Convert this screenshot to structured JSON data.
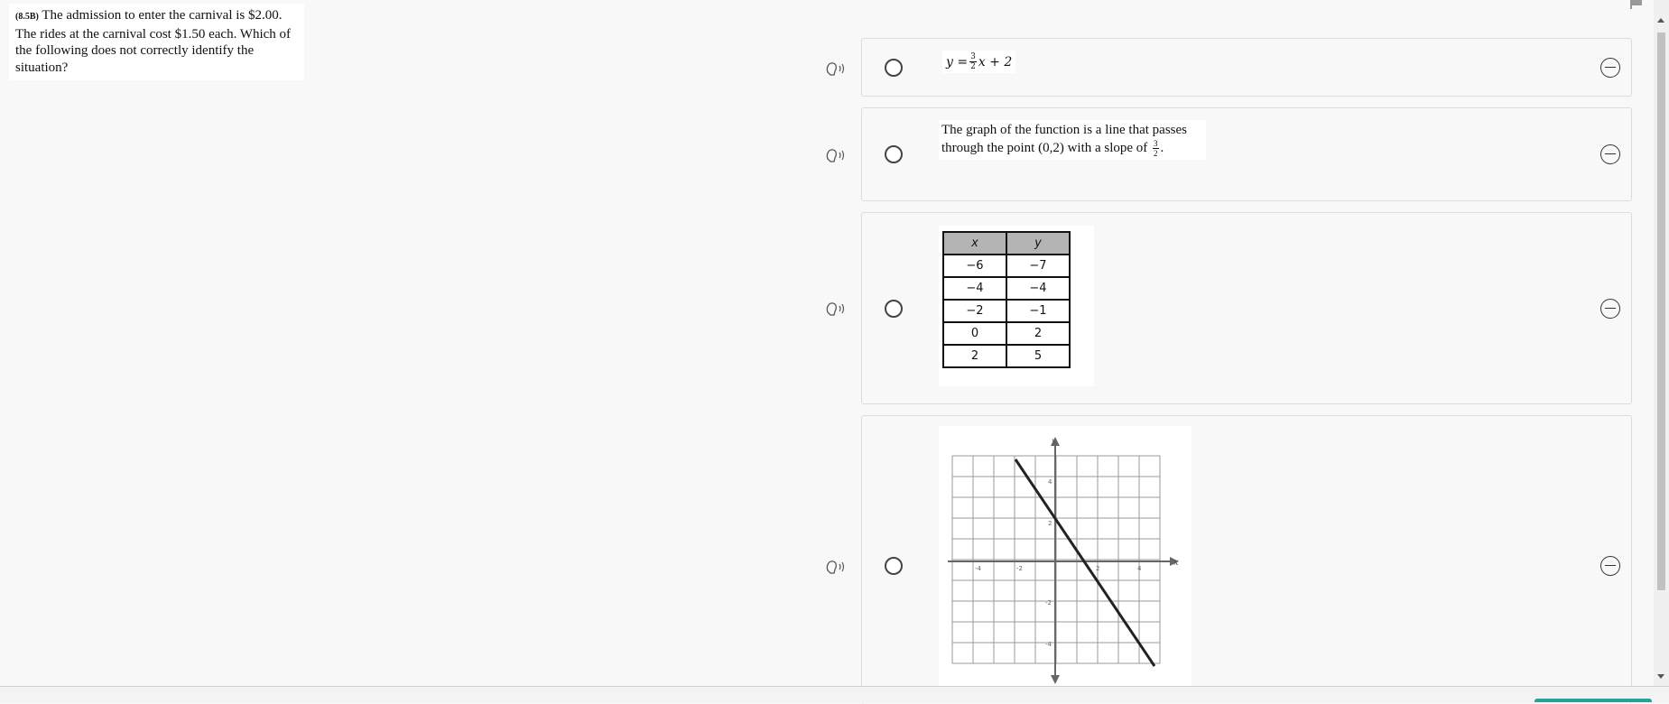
{
  "question": {
    "standard": "(8.5B)",
    "text": " The admission to enter the carnival is $2.00.  The rides at the carnival cost $1.50 each.  Which of the following does not correctly identify the situation?"
  },
  "options": {
    "a": {
      "equation_lhs": "y =",
      "frac_num": "3",
      "frac_den": "2",
      "equation_rhs": "x + 2"
    },
    "b": {
      "text": "The graph of the function is a line that passes through the point (0,2) with a slope of ",
      "frac_num": "3",
      "frac_den": "2",
      "end": "."
    },
    "c": {
      "headers": [
        "x",
        "y"
      ],
      "rows": [
        [
          "−6",
          "−7"
        ],
        [
          "−4",
          "−4"
        ],
        [
          "−2",
          "−1"
        ],
        [
          "0",
          "2"
        ],
        [
          "2",
          "5"
        ]
      ]
    },
    "d": {
      "graph_axis_x": "x",
      "graph_axis_y": "y",
      "tick_labels": [
        "-4",
        "-2",
        "2",
        "4",
        "4",
        "2",
        "-2",
        "-4"
      ]
    }
  },
  "icons": {
    "speak": "speaker-head-icon",
    "strike": "strikethrough-icon",
    "flag": "flag-icon"
  },
  "colors": {
    "table_header": "#b4b4b4",
    "accent": "#2aa198"
  }
}
